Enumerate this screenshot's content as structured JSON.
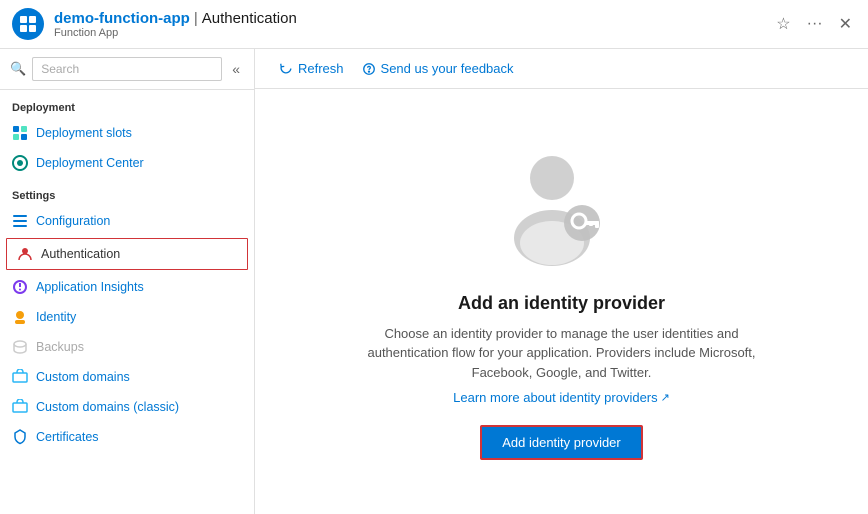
{
  "titleBar": {
    "appName": "demo-function-app",
    "divider": "|",
    "pageName": "Authentication",
    "subtitle": "Function App",
    "starIcon": "★",
    "moreIcon": "···",
    "closeIcon": "✕"
  },
  "sidebar": {
    "searchPlaceholder": "Search",
    "collapseIcon": "«",
    "sections": [
      {
        "label": "Deployment",
        "items": [
          {
            "id": "deployment-slots",
            "label": "Deployment slots",
            "iconColor": "blue"
          },
          {
            "id": "deployment-center",
            "label": "Deployment Center",
            "iconColor": "teal"
          }
        ]
      },
      {
        "label": "Settings",
        "items": [
          {
            "id": "configuration",
            "label": "Configuration",
            "iconColor": "blue"
          },
          {
            "id": "authentication",
            "label": "Authentication",
            "iconColor": "red",
            "active": true
          },
          {
            "id": "application-insights",
            "label": "Application Insights",
            "iconColor": "purple"
          },
          {
            "id": "identity",
            "label": "Identity",
            "iconColor": "yellow"
          },
          {
            "id": "backups",
            "label": "Backups",
            "iconColor": "gray",
            "disabled": true
          },
          {
            "id": "custom-domains",
            "label": "Custom domains",
            "iconColor": "lightblue"
          },
          {
            "id": "custom-domains-classic",
            "label": "Custom domains (classic)",
            "iconColor": "lightblue"
          },
          {
            "id": "certificates",
            "label": "Certificates",
            "iconColor": "blue"
          }
        ]
      }
    ]
  },
  "toolbar": {
    "refreshLabel": "Refresh",
    "feedbackLabel": "Send us your feedback"
  },
  "main": {
    "heading": "Add an identity provider",
    "description": "Choose an identity provider to manage the user identities and authentication flow for your application. Providers include Microsoft, Facebook, Google, and Twitter.",
    "linkText": "Learn more about identity providers",
    "addButtonLabel": "Add identity provider"
  }
}
